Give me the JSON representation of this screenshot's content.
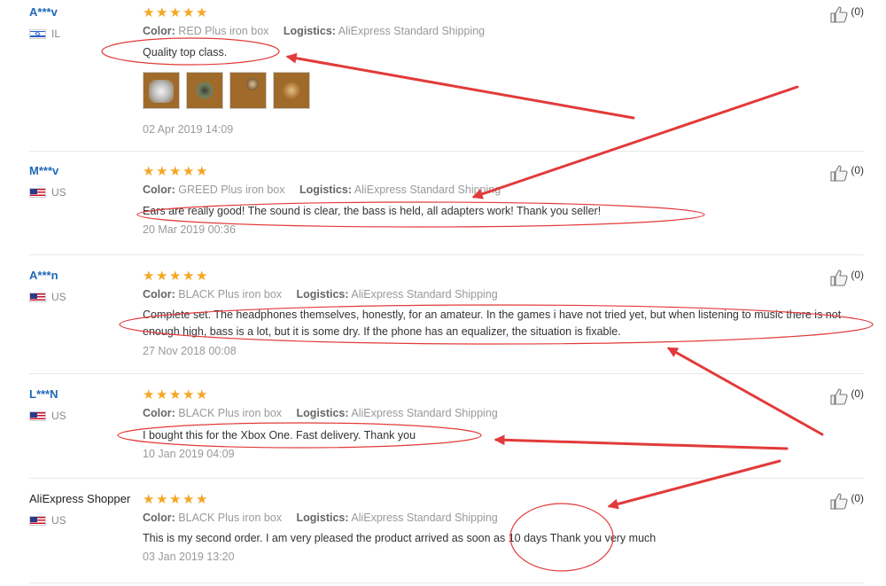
{
  "labels": {
    "color": "Color:",
    "logistics": "Logistics:"
  },
  "star_icon": "star-icon",
  "thumb_icon": "thumbs-up-icon",
  "accent_color": "#1f68b8",
  "star_color": "#f5a623",
  "annotation_color": "#e23a3a",
  "reviews": [
    {
      "user": "A***v",
      "country": "IL",
      "rating": 5,
      "color": "RED Plus iron box",
      "logistics": "AliExpress Standard Shipping",
      "text": "Quality top class.",
      "photo_count": 4,
      "date": "02 Apr 2019 14:09",
      "helpful": "(0)"
    },
    {
      "user": "M***v",
      "country": "US",
      "rating": 5,
      "color": "GREED Plus iron box",
      "logistics": "AliExpress Standard Shipping",
      "text": "Ears are really good! The sound is clear, the bass is held, all adapters work! Thank you seller!",
      "date": "20 Mar 2019 00:36",
      "helpful": "(0)"
    },
    {
      "user": "A***n",
      "country": "US",
      "rating": 5,
      "color": "BLACK Plus iron box",
      "logistics": "AliExpress Standard Shipping",
      "text": "Complete set. The headphones themselves, honestly, for an amateur. In the games i have not tried yet, but when listening to music there is not enough high, bass is a lot, but it is some dry. If the phone has an equalizer, the situation is fixable.",
      "date": "27 Nov 2018 00:08",
      "helpful": "(0)"
    },
    {
      "user": "L***N",
      "country": "US",
      "rating": 5,
      "color": "BLACK Plus iron box",
      "logistics": "AliExpress Standard Shipping",
      "text": "I bought this for the Xbox One. Fast delivery. Thank you",
      "date": "10 Jan 2019 04:09",
      "helpful": "(0)"
    },
    {
      "user": "AliExpress Shopper",
      "country": "US",
      "rating": 5,
      "color": "BLACK Plus iron box",
      "logistics": "AliExpress Standard Shipping",
      "text": "This is my second order. I am very pleased the product arrived as soon as 10 days Thank you very much",
      "date": "03 Jan 2019 13:20",
      "helpful": "(0)"
    }
  ]
}
